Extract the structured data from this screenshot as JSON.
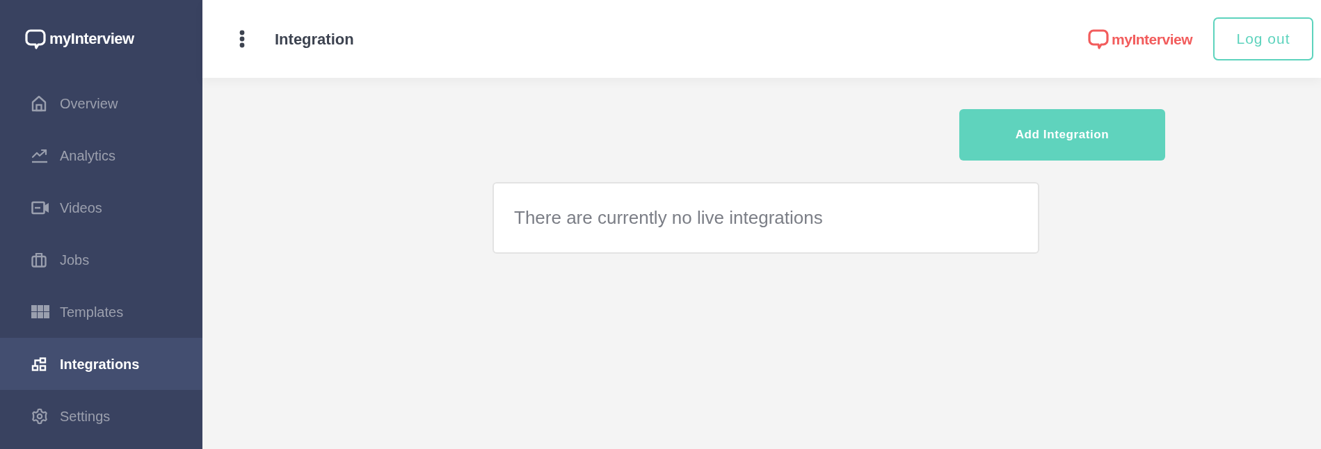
{
  "sidebar": {
    "logo": {
      "text": "myInterview"
    },
    "items": [
      {
        "label": "Overview",
        "kind": "home",
        "selected": false
      },
      {
        "label": "Analytics",
        "kind": "trend",
        "selected": false
      },
      {
        "label": "Videos",
        "kind": "camera",
        "selected": false
      },
      {
        "label": "Jobs",
        "kind": "briefcase",
        "selected": false
      },
      {
        "label": "Templates",
        "kind": "grid",
        "selected": false
      },
      {
        "label": "Integrations",
        "kind": "nodes",
        "selected": true
      },
      {
        "label": "Settings",
        "kind": "gear",
        "selected": false
      }
    ]
  },
  "header": {
    "title": "Integration",
    "logo": {
      "text": "myInterview"
    },
    "logout_button": "Log out"
  },
  "main": {
    "add_button": "Add Integration",
    "empty_message": "There are currently no live integrations"
  }
}
